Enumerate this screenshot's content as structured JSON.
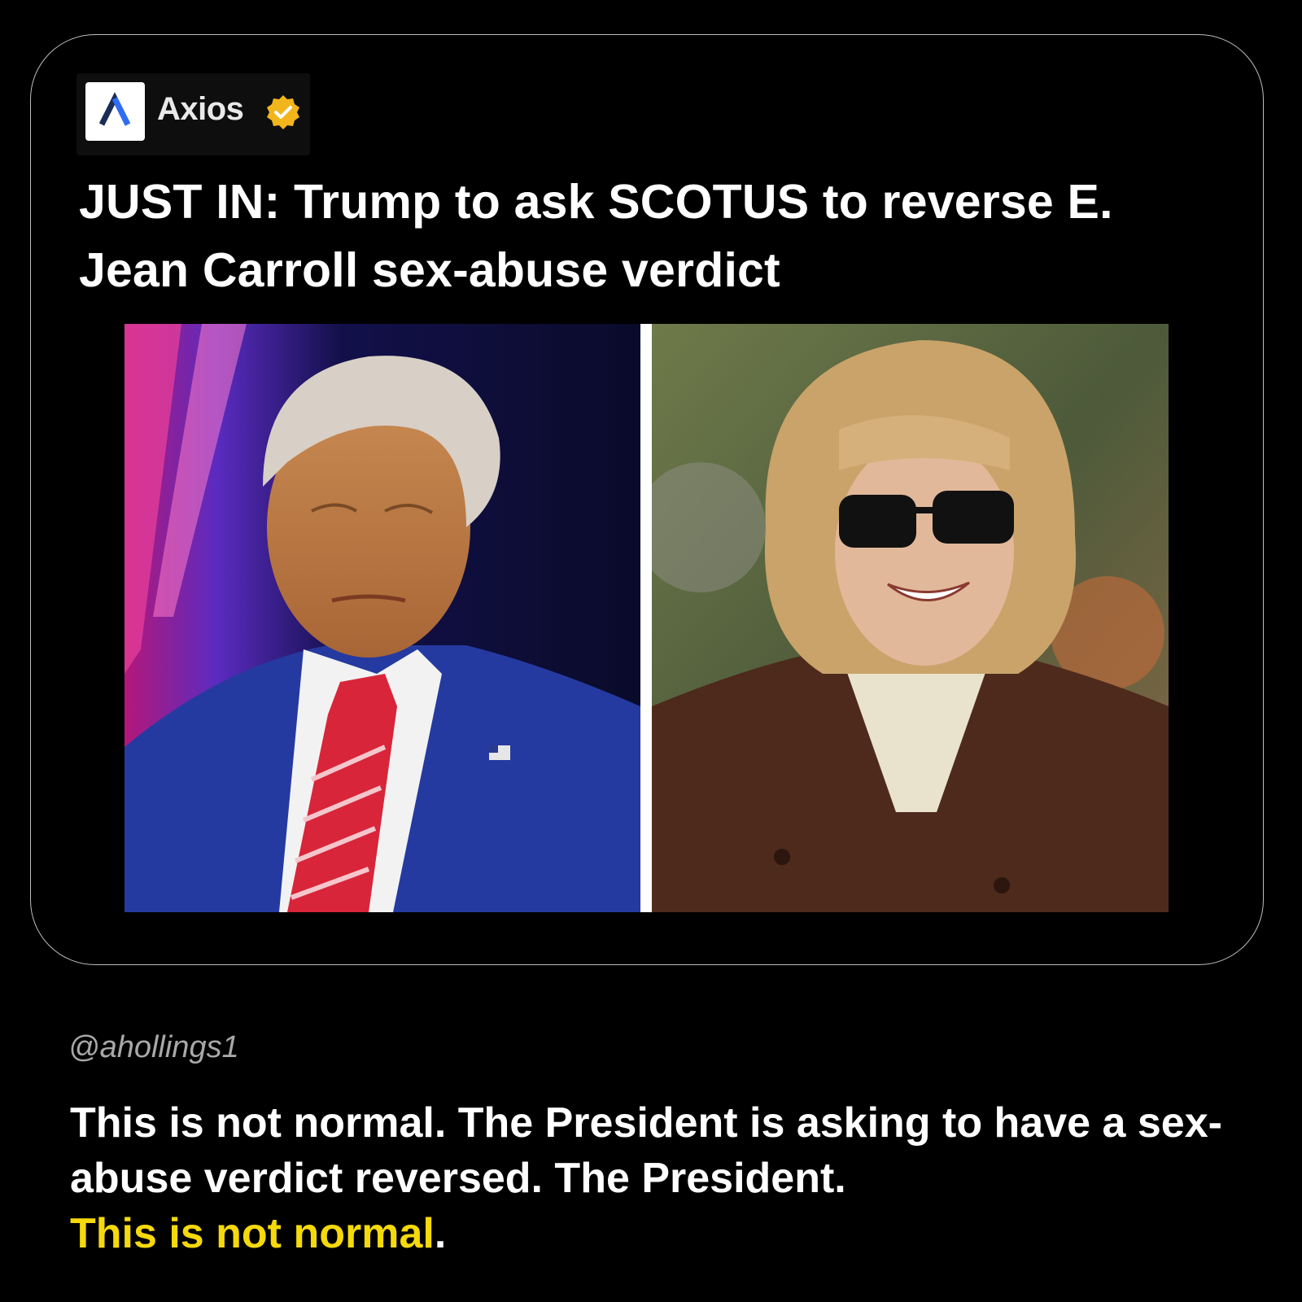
{
  "post": {
    "source": {
      "name": "Axios",
      "logo_icon": "axios-logo-icon",
      "verified_icon": "verified-badge-icon",
      "verified_color": "#f2b51c"
    },
    "headline": "JUST IN: Trump to ask SCOTUS to reverse E. Jean Carroll sex-abuse verdict",
    "images": {
      "left": "trump-photo",
      "right": "carroll-photo"
    }
  },
  "comment": {
    "handle": "@ahollings1",
    "text": "This is not normal. The President is asking to have a sex-abuse verdict reversed. The President.",
    "highlight": "This is not normal",
    "highlight_suffix": ".",
    "highlight_color": "#f5d90a"
  }
}
